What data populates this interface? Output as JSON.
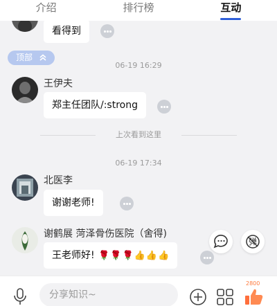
{
  "tabs": [
    {
      "label": "介绍",
      "active": false
    },
    {
      "label": "排行榜",
      "active": false
    },
    {
      "label": "互动",
      "active": true
    }
  ],
  "top_button": {
    "label": "顶部",
    "icon": "double-chevron-up-icon"
  },
  "messages": [
    {
      "text": "看得到"
    },
    {
      "timestamp": "06-19 16:29",
      "author": "王伊夫",
      "text": "郑主任团队/:strong"
    },
    {
      "author": "北医李",
      "text": "谢谢老师!"
    },
    {
      "author": "谢鹤展 菏泽骨伤医院（舍得)",
      "text": "王老师好!",
      "emojis": [
        "🌹",
        "🌹",
        "🌹",
        "👍",
        "👍",
        "👍"
      ]
    }
  ],
  "last_seen_label": "上次看到这里",
  "timestamp2": "06-19 17:34",
  "side_buttons": {
    "comment_icon": "chat-bubble-icon",
    "barrage_label": "弹"
  },
  "bottom": {
    "mic_icon": "microphone-icon",
    "input_placeholder": "分享知识~",
    "add_icon": "plus-circle-icon",
    "grid_icon": "grid-icon",
    "like_count": "2800",
    "like_icon": "thumbs-up-icon"
  },
  "colors": {
    "accent": "#2f5fd8",
    "pill": "#b6c8ef",
    "like": "#ff7a3d"
  }
}
